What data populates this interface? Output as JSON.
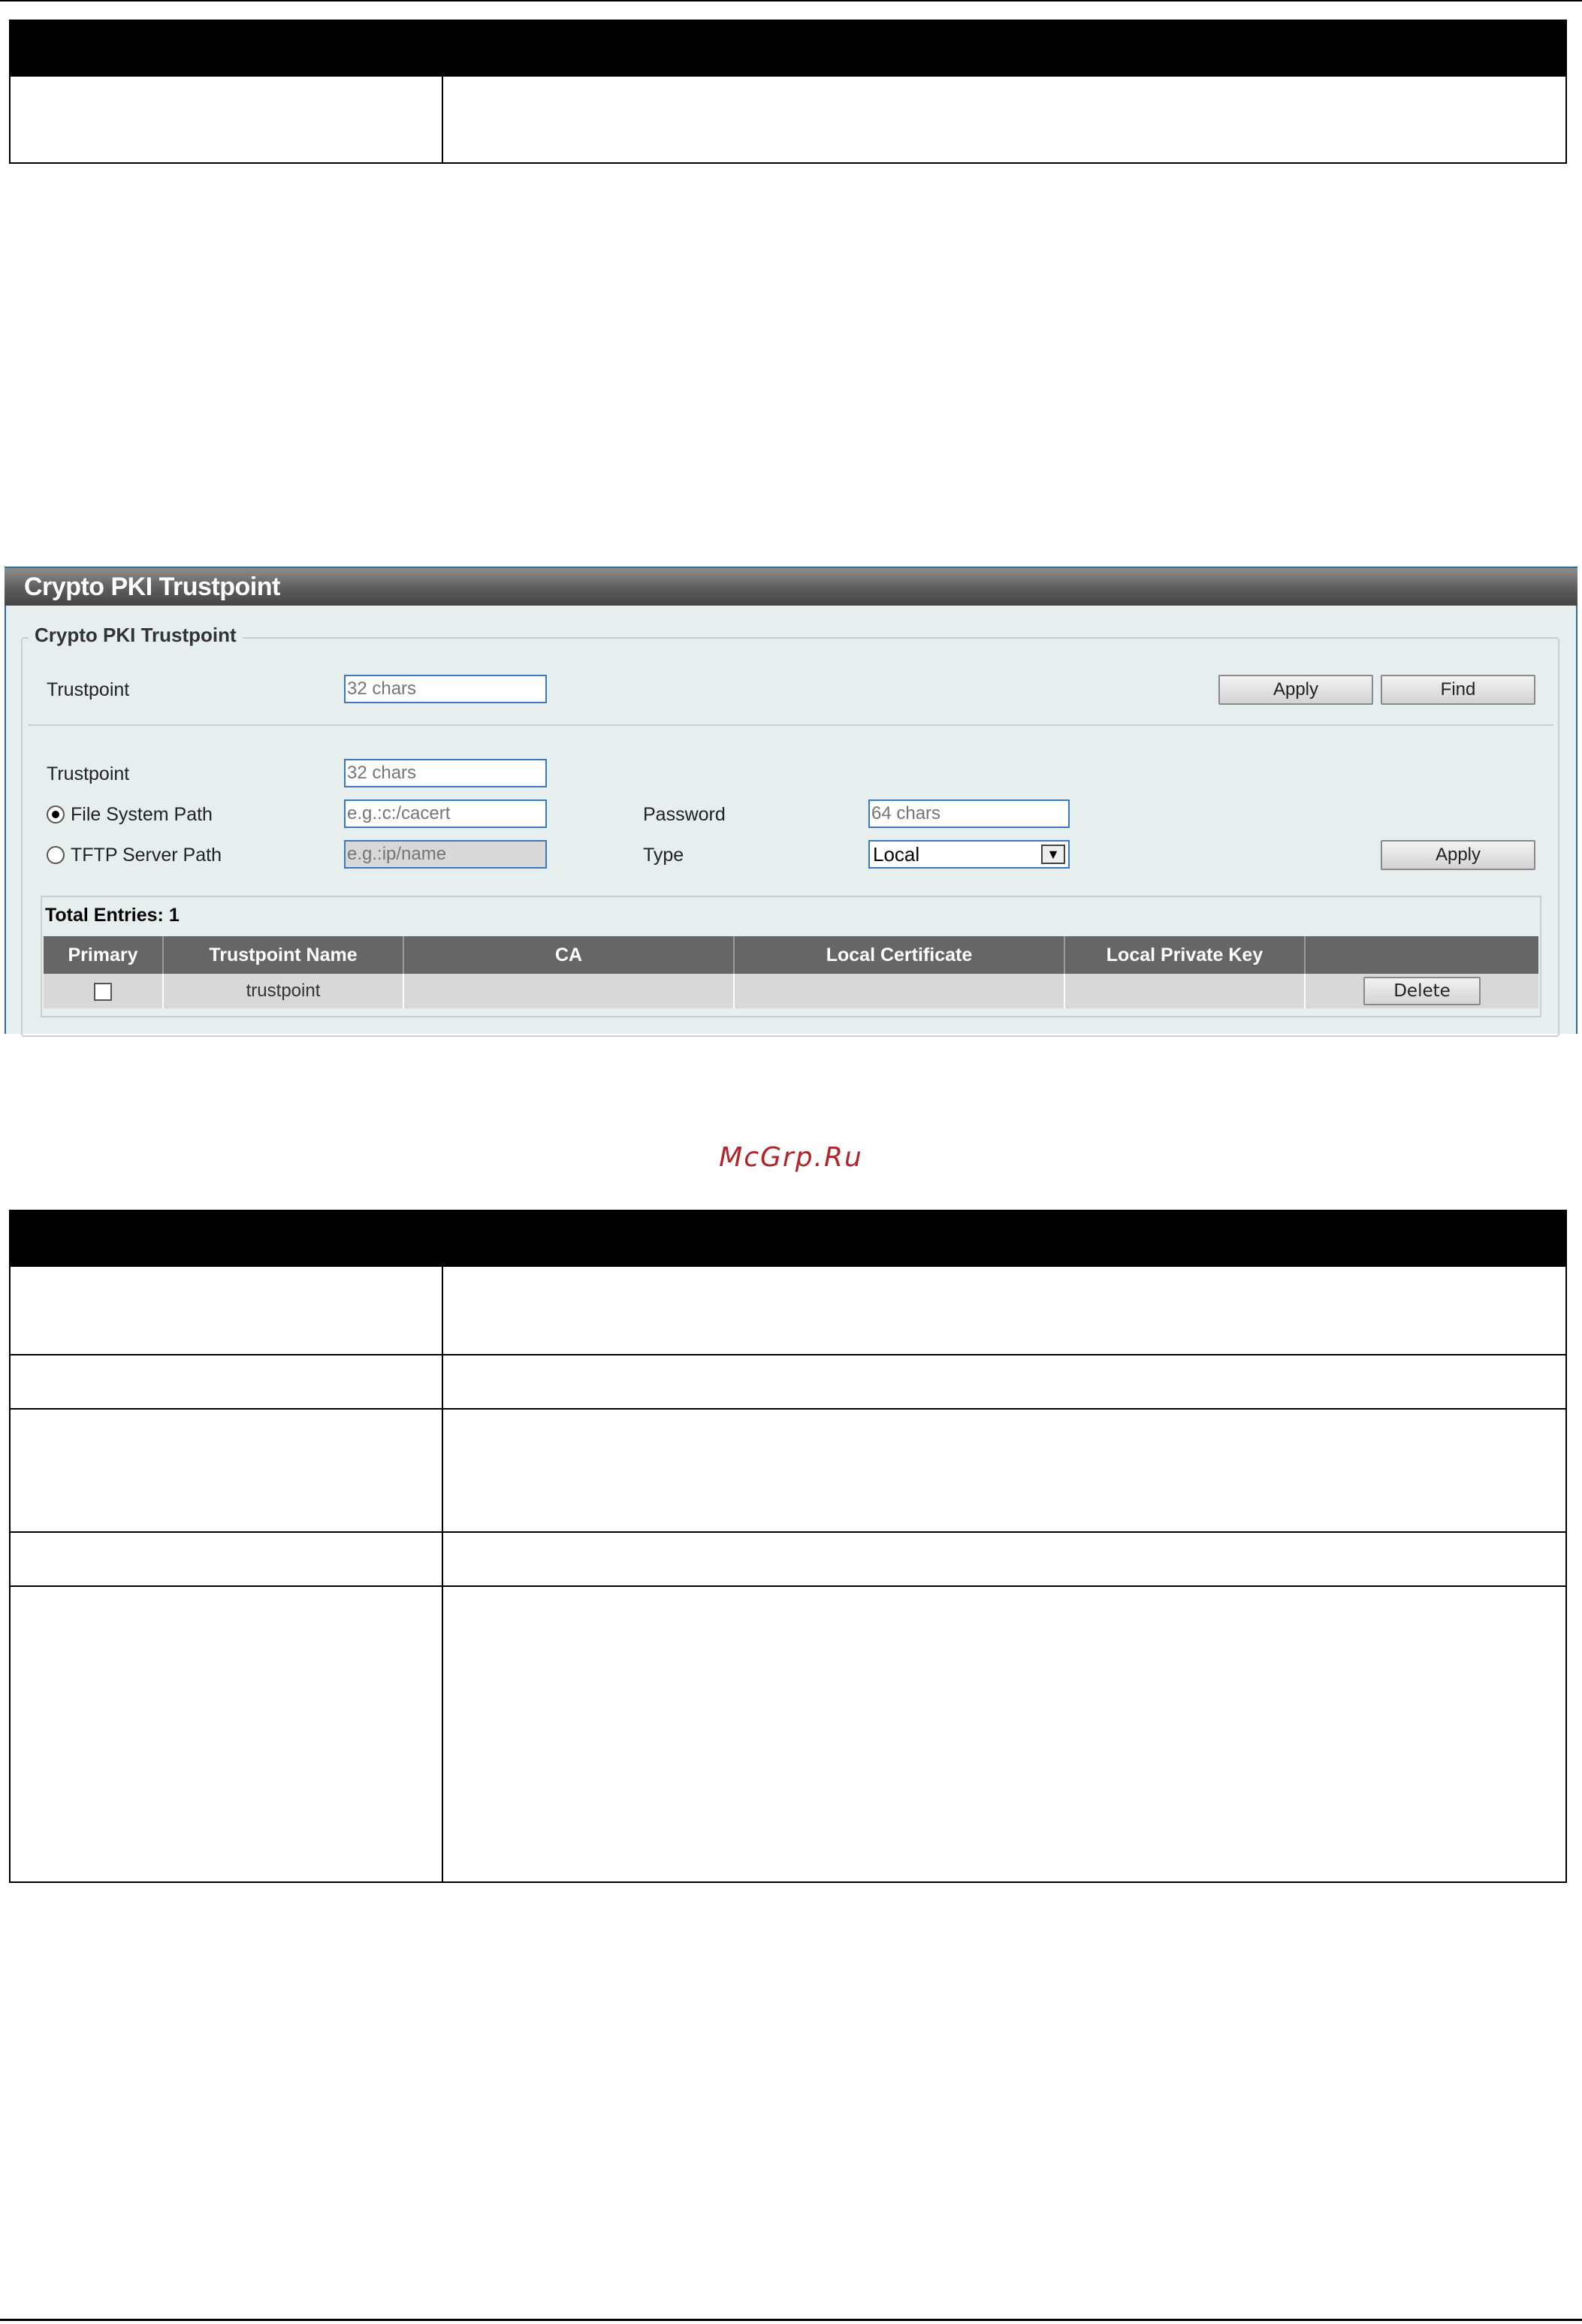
{
  "panel": {
    "title": "Crypto PKI Trustpoint",
    "section_legend": "Crypto PKI Trustpoint",
    "find_form": {
      "trustpoint_label": "Trustpoint",
      "trustpoint_placeholder": "32 chars",
      "apply_label": "Apply",
      "find_label": "Find"
    },
    "import_form": {
      "trustpoint_label": "Trustpoint",
      "trustpoint_placeholder": "32 chars",
      "file_system_path_label": "File System Path",
      "file_system_path_placeholder": "e.g.:c:/cacert",
      "file_system_path_selected": true,
      "tftp_server_path_label": "TFTP Server Path",
      "tftp_server_path_placeholder": "e.g.:ip/name",
      "password_label": "Password",
      "password_placeholder": "64 chars",
      "type_label": "Type",
      "type_value": "Local",
      "apply_label": "Apply"
    },
    "total_entries": "Total Entries: 1",
    "table": {
      "columns": [
        "Primary",
        "Trustpoint Name",
        "CA",
        "Local Certificate",
        "Local Private Key",
        ""
      ],
      "rows": [
        {
          "primary_checked": false,
          "trustpoint_name": "trustpoint",
          "ca": "",
          "local_certificate": "",
          "local_private_key": "",
          "action": "Delete"
        }
      ]
    }
  },
  "watermark": "McGrp.Ru"
}
